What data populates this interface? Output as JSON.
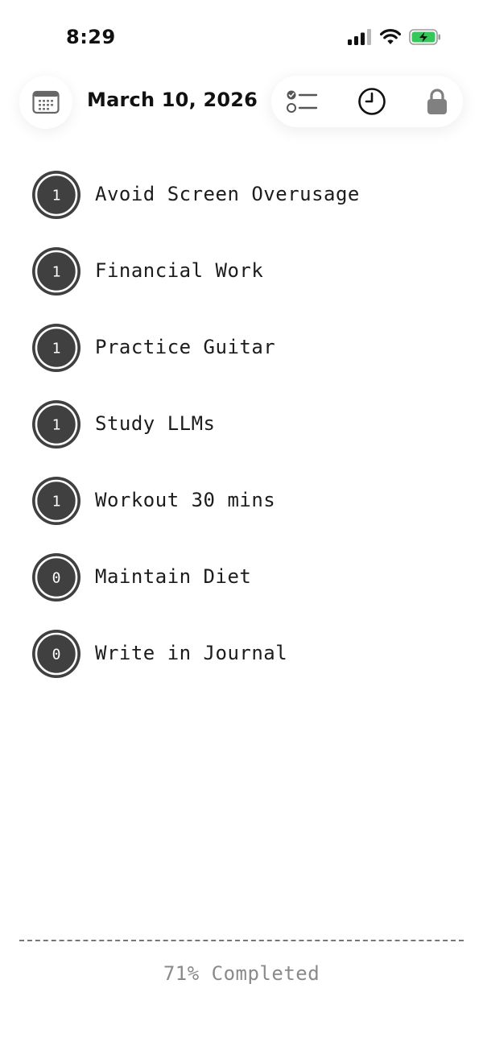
{
  "status_bar": {
    "time": "8:29",
    "icons": [
      "cellular-signal-icon",
      "wifi-icon",
      "battery-charging-icon"
    ]
  },
  "header": {
    "date": "March 10, 2026",
    "icons": {
      "calendar": "calendar-icon",
      "list": "checklist-icon",
      "history": "clock-icon",
      "lock": "lock-icon"
    }
  },
  "habits": [
    {
      "count": "1",
      "label": "Avoid Screen Overusage"
    },
    {
      "count": "1",
      "label": "Financial Work"
    },
    {
      "count": "1",
      "label": "Practice Guitar"
    },
    {
      "count": "1",
      "label": "Study LLMs"
    },
    {
      "count": "1",
      "label": "Workout 30 mins"
    },
    {
      "count": "0",
      "label": "Maintain Diet"
    },
    {
      "count": "0",
      "label": "Write in Journal"
    }
  ],
  "footer": {
    "progress": "71% Completed"
  },
  "colors": {
    "badge_fill": "#404040",
    "text": "#1c1c1c",
    "muted_text": "#8a8a8a",
    "battery_green": "#34c759"
  }
}
